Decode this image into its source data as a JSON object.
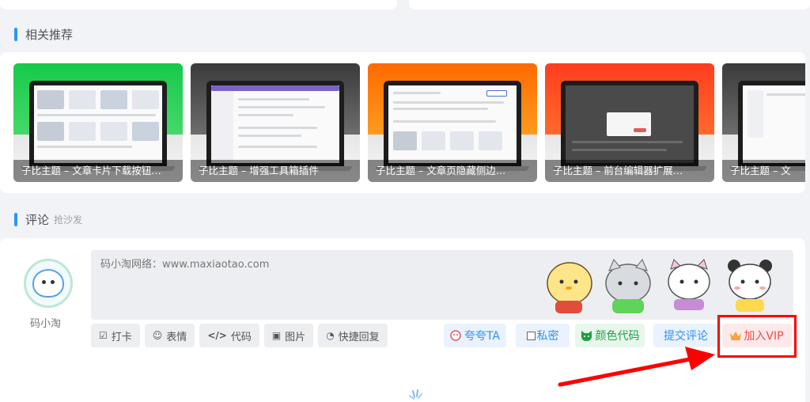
{
  "related": {
    "title": "相关推荐",
    "items": [
      {
        "caption": "子比主题 – 文章卡片下载按钮…",
        "theme": "green"
      },
      {
        "caption": "子比主题 – 增强工具箱插件",
        "theme": "gray"
      },
      {
        "caption": "子比主题 – 文章页隐藏侧边…",
        "theme": "orange"
      },
      {
        "caption": "子比主题 – 前台编辑器扩展…",
        "theme": "red"
      },
      {
        "caption": "子比主题 – 文",
        "theme": "gray"
      }
    ]
  },
  "comments": {
    "title": "评论",
    "subtitle": "抢沙发",
    "user_name": "码小淘",
    "placeholder": "码小淘网络：www.maxiaotao.com",
    "tools": [
      {
        "icon": "checkbox-icon",
        "glyph": "☑",
        "label": "打卡"
      },
      {
        "icon": "smiley-icon",
        "glyph": "☺",
        "label": "表情"
      },
      {
        "icon": "code-icon",
        "glyph": "</>",
        "label": "代码"
      },
      {
        "icon": "image-icon",
        "glyph": "▣",
        "label": "图片"
      },
      {
        "icon": "quick-reply-icon",
        "glyph": "◔",
        "label": "快捷回复"
      }
    ],
    "praise_label": "夸夸TA",
    "private_label": "私密",
    "color_code_label": "颜色代码",
    "submit_label": "提交评论",
    "vip_label": "加入VIP"
  },
  "colors": {
    "accent": "#2997f7",
    "vip": "#f04b4b",
    "highlight": "#ff0000",
    "green": "#1f9f44"
  }
}
